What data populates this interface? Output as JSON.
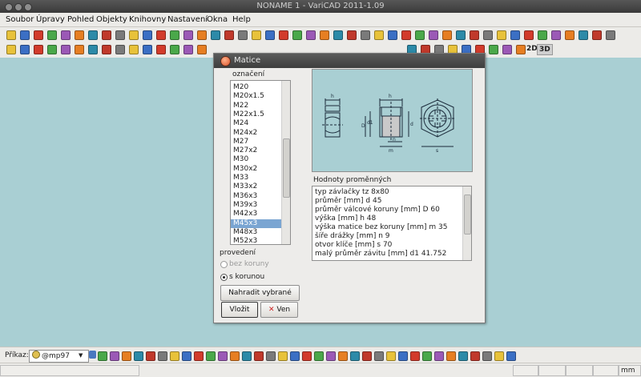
{
  "window": {
    "title": "NONAME 1 - VariCAD 2011-1.09"
  },
  "menu": [
    "Soubor",
    "Úpravy",
    "Pohled",
    "Objekty",
    "Knihovny",
    "Nastavení",
    "Okna",
    "Help"
  ],
  "toolbar": {
    "label_2d": "2D",
    "label_3d": "3D"
  },
  "dialog": {
    "title": "Matice",
    "designation_label": "označení",
    "designation_list": [
      "M20",
      "M20x1.5",
      "M22",
      "M22x1.5",
      "M24",
      "M24x2",
      "M27",
      "M27x2",
      "M30",
      "M30x2",
      "M33",
      "M33x2",
      "M36x3",
      "M39x3",
      "M42x3",
      "M45x3",
      "M48x3",
      "M52x3"
    ],
    "selected_designation": "M45x3",
    "variant_label": "provedení",
    "variants": [
      {
        "label": "bez koruny",
        "selected": false,
        "enabled": false
      },
      {
        "label": "s korunou",
        "selected": true,
        "enabled": true
      }
    ],
    "replace_button": "Nahradit vybrané",
    "ok_button": "Vložit",
    "cancel_button": "Ven",
    "values_label": "Hodnoty proměnných",
    "values": [
      "typ závlačky tz 8x80",
      "průměr [mm] d 45",
      "průměr válcové koruny [mm] D 60",
      "výška [mm] h 48",
      "výška matice bez koruny [mm] m 35",
      "šíře drážky [mm] n 9",
      "otvor klíče [mm] s 70",
      "malý průměr závitu [mm] d1 41.752"
    ]
  },
  "status": {
    "command_label": "Příkaz:",
    "command_value": "@mp97",
    "unit": "mm"
  },
  "colors": {
    "canvas": "#a9cfd3",
    "selection": "#7aa5d2",
    "dialog_bg": "#edecea"
  }
}
